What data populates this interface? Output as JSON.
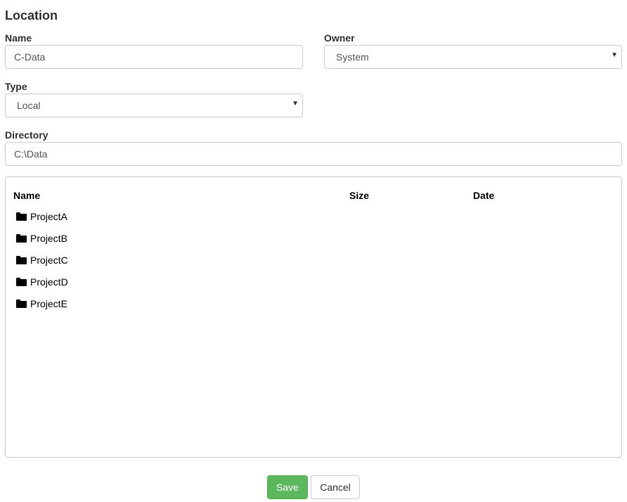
{
  "page_title": "Location",
  "form": {
    "name": {
      "label": "Name",
      "value": "C-Data"
    },
    "owner": {
      "label": "Owner",
      "selected": "System"
    },
    "type": {
      "label": "Type",
      "selected": "Local"
    },
    "directory": {
      "label": "Directory",
      "value": "C:\\Data"
    }
  },
  "browser": {
    "columns": [
      "Name",
      "Size",
      "Date"
    ],
    "items": [
      {
        "name": "ProjectA",
        "icon": "folder-icon"
      },
      {
        "name": "ProjectB",
        "icon": "folder-icon"
      },
      {
        "name": "ProjectC",
        "icon": "folder-icon"
      },
      {
        "name": "ProjectD",
        "icon": "folder-icon"
      },
      {
        "name": "ProjectE",
        "icon": "folder-icon"
      }
    ]
  },
  "actions": {
    "save_label": "Save",
    "cancel_label": "Cancel"
  },
  "colors": {
    "save_button": "#5cb85c",
    "border": "#cccccc",
    "text": "#333333"
  }
}
